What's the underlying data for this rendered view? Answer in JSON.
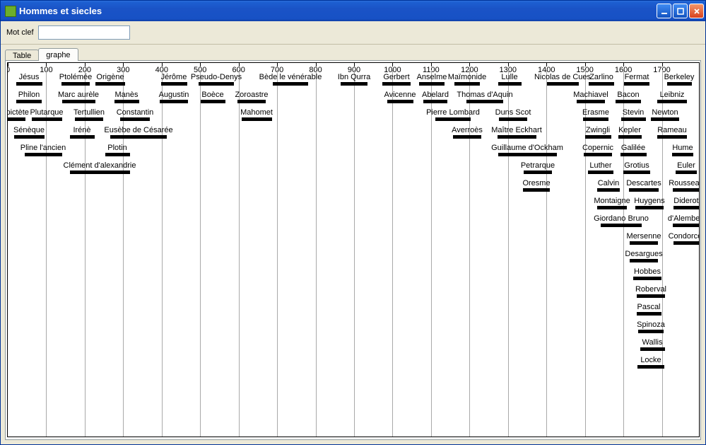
{
  "window": {
    "title": "Hommes et siecles"
  },
  "toolbar": {
    "keyword_label": "Mot clef",
    "keyword_value": ""
  },
  "tabs": [
    {
      "id": "table",
      "label": "Table",
      "active": false
    },
    {
      "id": "graphe",
      "label": "graphe",
      "active": true
    }
  ],
  "chart_data": {
    "type": "bar",
    "x_range": [
      0,
      1800
    ],
    "tick_step": 100,
    "ticks": [
      0,
      100,
      200,
      300,
      400,
      500,
      600,
      700,
      800,
      900,
      1000,
      1100,
      1200,
      1300,
      1400,
      1500,
      1600,
      1700
    ],
    "people": [
      {
        "name": "Jésus",
        "row": 0,
        "center": 30,
        "left": 8,
        "right": 45
      },
      {
        "name": "Ptolémée",
        "row": 0,
        "center": 96,
        "left": 75,
        "right": 115
      },
      {
        "name": "Origène",
        "row": 0,
        "center": 145,
        "left": 128,
        "right": 170
      },
      {
        "name": "Jérôme",
        "row": 0,
        "center": 235,
        "left": 218,
        "right": 255
      },
      {
        "name": "Pseudo-Denys",
        "row": 0,
        "center": 295,
        "left": 270,
        "right": 320
      },
      {
        "name": "Bède le vénérable",
        "row": 0,
        "center": 400,
        "left": 375,
        "right": 425
      },
      {
        "name": "Ibn Qurra",
        "row": 0,
        "center": 490,
        "left": 472,
        "right": 510
      },
      {
        "name": "Gerbert",
        "row": 0,
        "center": 550,
        "left": 530,
        "right": 570
      },
      {
        "name": "Anselme",
        "row": 0,
        "center": 600,
        "left": 582,
        "right": 618
      },
      {
        "name": "Maïmonide",
        "row": 0,
        "center": 650,
        "left": 632,
        "right": 668
      },
      {
        "name": "Lulle",
        "row": 0,
        "center": 710,
        "left": 695,
        "right": 728
      },
      {
        "name": "Nicolas de Cues",
        "row": 0,
        "center": 785,
        "left": 760,
        "right": 805
      },
      {
        "name": "Zarlino",
        "row": 0,
        "center": 840,
        "left": 824,
        "right": 860
      },
      {
        "name": "Fermat",
        "row": 0,
        "center": 890,
        "left": 872,
        "right": 908
      },
      {
        "name": "Berkeley",
        "row": 0,
        "center": 950,
        "left": 930,
        "right": 965
      },
      {
        "name": "Philon",
        "row": 1,
        "center": 30,
        "left": 12,
        "right": 48
      },
      {
        "name": "Marc aurèle",
        "row": 1,
        "center": 100,
        "left": 78,
        "right": 125
      },
      {
        "name": "Manès",
        "row": 1,
        "center": 168,
        "left": 150,
        "right": 185
      },
      {
        "name": "Augustin",
        "row": 1,
        "center": 235,
        "left": 215,
        "right": 255
      },
      {
        "name": "Boèce",
        "row": 1,
        "center": 290,
        "left": 270,
        "right": 305
      },
      {
        "name": "Zoroastre",
        "row": 1,
        "center": 345,
        "left": 325,
        "right": 365
      },
      {
        "name": "Avicenne",
        "row": 1,
        "center": 555,
        "left": 538,
        "right": 575
      },
      {
        "name": "Abelard",
        "row": 1,
        "center": 605,
        "left": 588,
        "right": 622
      },
      {
        "name": "Thomas d'Aquin",
        "row": 1,
        "center": 675,
        "left": 650,
        "right": 702
      },
      {
        "name": "Machiavel",
        "row": 1,
        "center": 825,
        "left": 805,
        "right": 845
      },
      {
        "name": "Bacon",
        "row": 1,
        "center": 878,
        "left": 862,
        "right": 898
      },
      {
        "name": "Leibniz",
        "row": 1,
        "center": 940,
        "left": 918,
        "right": 960
      },
      {
        "name": "Epictète",
        "row": 2,
        "center": 10,
        "left": 0,
        "right": 30
      },
      {
        "name": "Plutarque",
        "row": 2,
        "center": 55,
        "left": 35,
        "right": 78
      },
      {
        "name": "Tertullien",
        "row": 2,
        "center": 115,
        "left": 95,
        "right": 135
      },
      {
        "name": "Constantin",
        "row": 2,
        "center": 180,
        "left": 158,
        "right": 200
      },
      {
        "name": "Mahomet",
        "row": 2,
        "center": 352,
        "left": 335,
        "right": 378
      },
      {
        "name": "Pierre Lombard",
        "row": 2,
        "center": 630,
        "left": 605,
        "right": 655
      },
      {
        "name": "Duns Scot",
        "row": 2,
        "center": 715,
        "left": 695,
        "right": 735
      },
      {
        "name": "Erasme",
        "row": 2,
        "center": 832,
        "left": 814,
        "right": 850
      },
      {
        "name": "Stevin",
        "row": 2,
        "center": 885,
        "left": 868,
        "right": 903
      },
      {
        "name": "Newton",
        "row": 2,
        "center": 930,
        "left": 910,
        "right": 950
      },
      {
        "name": "Sénèque",
        "row": 3,
        "center": 30,
        "left": 12,
        "right": 55
      },
      {
        "name": "Irénè",
        "row": 3,
        "center": 105,
        "left": 90,
        "right": 125
      },
      {
        "name": "Eusèbe de Césarée",
        "row": 3,
        "center": 185,
        "left": 145,
        "right": 225
      },
      {
        "name": "Averroès",
        "row": 3,
        "center": 650,
        "left": 630,
        "right": 670
      },
      {
        "name": "Maître Eckhart",
        "row": 3,
        "center": 720,
        "left": 695,
        "right": 750
      },
      {
        "name": "Zwingli",
        "row": 3,
        "center": 835,
        "left": 818,
        "right": 855
      },
      {
        "name": "Kepler",
        "row": 3,
        "center": 880,
        "left": 865,
        "right": 898
      },
      {
        "name": "Rameau",
        "row": 3,
        "center": 940,
        "left": 918,
        "right": 960
      },
      {
        "name": "Pline l'ancien",
        "row": 4,
        "center": 50,
        "left": 25,
        "right": 78
      },
      {
        "name": "Plotin",
        "row": 4,
        "center": 155,
        "left": 140,
        "right": 175
      },
      {
        "name": "Guillaume d'Ockham",
        "row": 4,
        "center": 735,
        "left": 695,
        "right": 778
      },
      {
        "name": "Copernic",
        "row": 4,
        "center": 835,
        "left": 815,
        "right": 855
      },
      {
        "name": "Galilée",
        "row": 4,
        "center": 885,
        "left": 868,
        "right": 905
      },
      {
        "name": "Hume",
        "row": 4,
        "center": 955,
        "left": 940,
        "right": 970
      },
      {
        "name": "Clément d'alexandrie",
        "row": 5,
        "center": 130,
        "left": 90,
        "right": 175
      },
      {
        "name": "Petrarque",
        "row": 5,
        "center": 750,
        "left": 730,
        "right": 770
      },
      {
        "name": "Luther",
        "row": 5,
        "center": 839,
        "left": 822,
        "right": 858
      },
      {
        "name": "Grotius",
        "row": 5,
        "center": 890,
        "left": 872,
        "right": 910
      },
      {
        "name": "Euler",
        "row": 5,
        "center": 960,
        "left": 945,
        "right": 975
      },
      {
        "name": "Oresme",
        "row": 6,
        "center": 748,
        "left": 730,
        "right": 768
      },
      {
        "name": "Calvin",
        "row": 6,
        "center": 850,
        "left": 835,
        "right": 867
      },
      {
        "name": "Descartes",
        "row": 6,
        "center": 900,
        "left": 878,
        "right": 920
      },
      {
        "name": "Rousseau",
        "row": 6,
        "center": 960,
        "left": 940,
        "right": 978
      },
      {
        "name": "Montaigne",
        "row": 7,
        "center": 855,
        "left": 835,
        "right": 877
      },
      {
        "name": "Huygens",
        "row": 7,
        "center": 908,
        "left": 888,
        "right": 928
      },
      {
        "name": "Diderot",
        "row": 7,
        "center": 960,
        "left": 942,
        "right": 978
      },
      {
        "name": "Giordano Bruno",
        "row": 8,
        "center": 868,
        "left": 840,
        "right": 898
      },
      {
        "name": "d'Alembert",
        "row": 8,
        "center": 960,
        "left": 940,
        "right": 978
      },
      {
        "name": "Mersenne",
        "row": 9,
        "center": 900,
        "left": 880,
        "right": 920
      },
      {
        "name": "Condorcet",
        "row": 9,
        "center": 960,
        "left": 942,
        "right": 978
      },
      {
        "name": "Desargues",
        "row": 10,
        "center": 900,
        "left": 880,
        "right": 920
      },
      {
        "name": "Hobbes",
        "row": 11,
        "center": 905,
        "left": 885,
        "right": 925
      },
      {
        "name": "Roberval",
        "row": 12,
        "center": 910,
        "left": 890,
        "right": 930
      },
      {
        "name": "Pascal",
        "row": 13,
        "center": 907,
        "left": 890,
        "right": 925
      },
      {
        "name": "Spinoza",
        "row": 14,
        "center": 910,
        "left": 892,
        "right": 928
      },
      {
        "name": "Wallis",
        "row": 15,
        "center": 912,
        "left": 895,
        "right": 930
      },
      {
        "name": "Locke",
        "row": 16,
        "center": 910,
        "left": 892,
        "right": 930
      }
    ]
  }
}
